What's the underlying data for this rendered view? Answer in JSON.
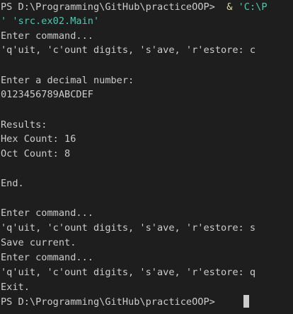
{
  "lines": {
    "l1_prompt": "PS D:\\Programming\\GitHub\\practiceOOP>",
    "l1_op": "  & ",
    "l1_arg": "'C:\\P",
    "l2_arg": "' 'src.ex02.Main'",
    "l3": "Enter command...",
    "l4": "'q'uit, 'c'ount digits, 's'ave, 'r'estore: c",
    "l6": "Enter a decimal number:",
    "l7": "0123456789ABCDEF",
    "l9": "Results:",
    "l10": "Hex Count: 16",
    "l11": "Oct Count: 8",
    "l13": "End.",
    "l15": "Enter command...",
    "l16": "'q'uit, 'c'ount digits, 's'ave, 'r'estore: s",
    "l17": "Save current.",
    "l18": "Enter command...",
    "l19": "'q'uit, 'c'ount digits, 's'ave, 'r'estore: q",
    "l20": "Exit.",
    "l21_prompt": "PS D:\\Programming\\GitHub\\practiceOOP> "
  },
  "colors": {
    "background": "#1e1e1e",
    "text": "#cccccc",
    "operator": "#dcdcaa",
    "string": "#4ec9b0"
  }
}
